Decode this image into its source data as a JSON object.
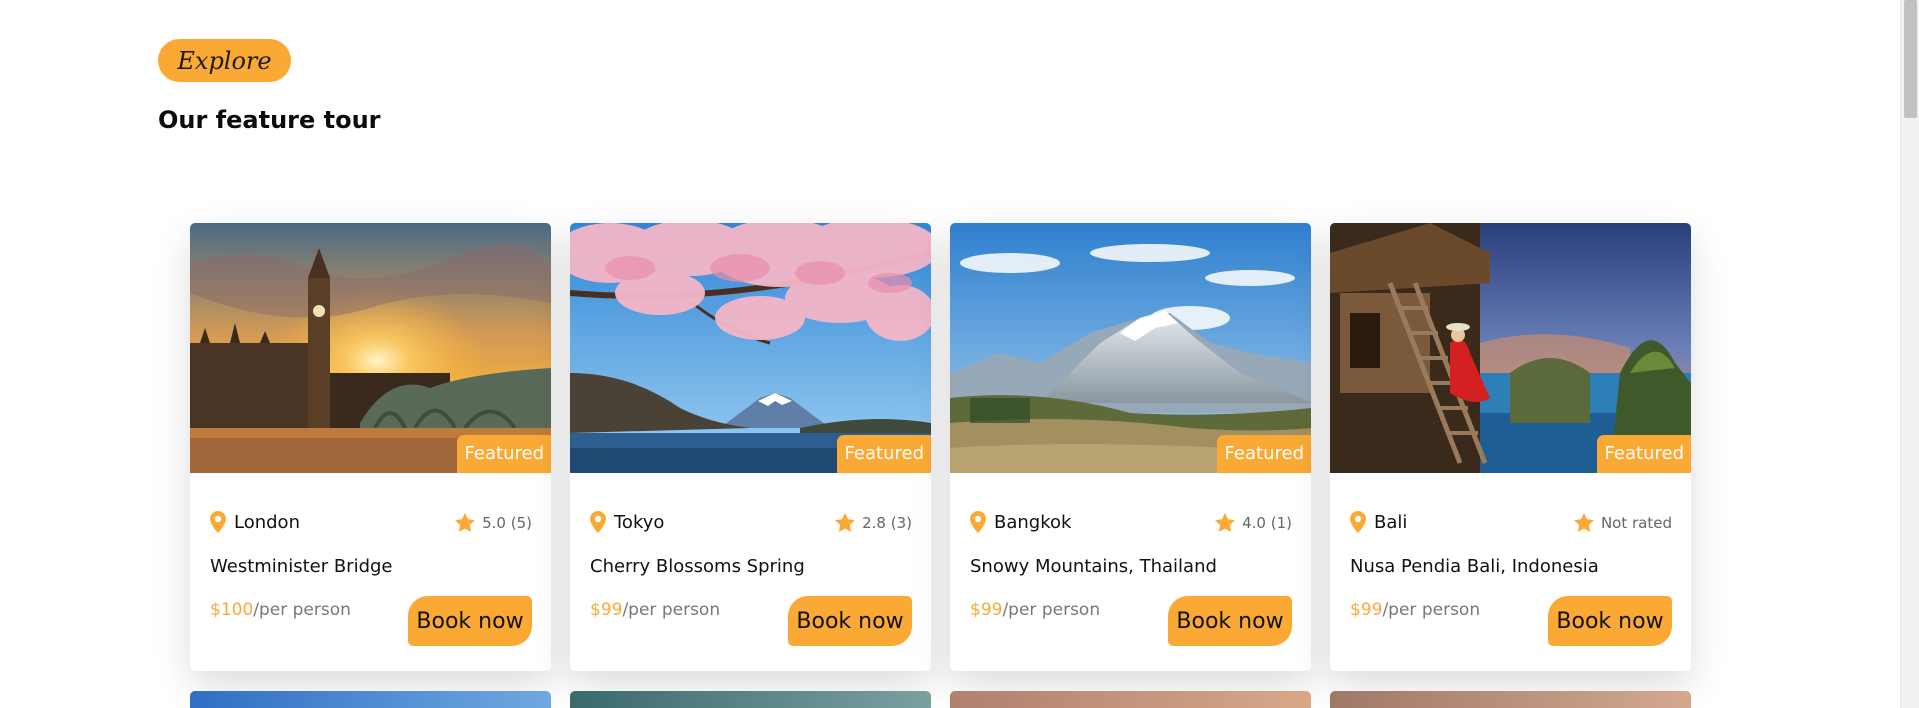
{
  "header": {
    "explore_label": "Explore",
    "section_title": "Our feature tour"
  },
  "colors": {
    "accent": "#faa935",
    "text_dark": "#111111",
    "text_muted": "#777777"
  },
  "tours": [
    {
      "city": "London",
      "rating": "5.0 (5)",
      "title": "Westminister Bridge",
      "price": "$100",
      "price_unit": "/per person",
      "tag": "Featured",
      "cta": "Book now",
      "image": "london-big-ben-sunset"
    },
    {
      "city": "Tokyo",
      "rating": "2.8 (3)",
      "title": "Cherry Blossoms Spring",
      "price": "$99",
      "price_unit": "/per person",
      "tag": "Featured",
      "cta": "Book now",
      "image": "cherry-blossom-mount-fuji"
    },
    {
      "city": "Bangkok",
      "rating": "4.0 (1)",
      "title": "Snowy Mountains, Thailand",
      "price": "$99",
      "price_unit": "/per person",
      "tag": "Featured",
      "cta": "Book now",
      "image": "snowy-mountains-valley"
    },
    {
      "city": "Bali",
      "rating": "Not rated",
      "title": "Nusa Pendia Bali, Indonesia",
      "price": "$99",
      "price_unit": "/per person",
      "tag": "Featured",
      "cta": "Book now",
      "image": "treehouse-woman-red-dress-sea"
    }
  ],
  "icons": {
    "location": "map-pin-icon",
    "rating": "star-icon"
  }
}
